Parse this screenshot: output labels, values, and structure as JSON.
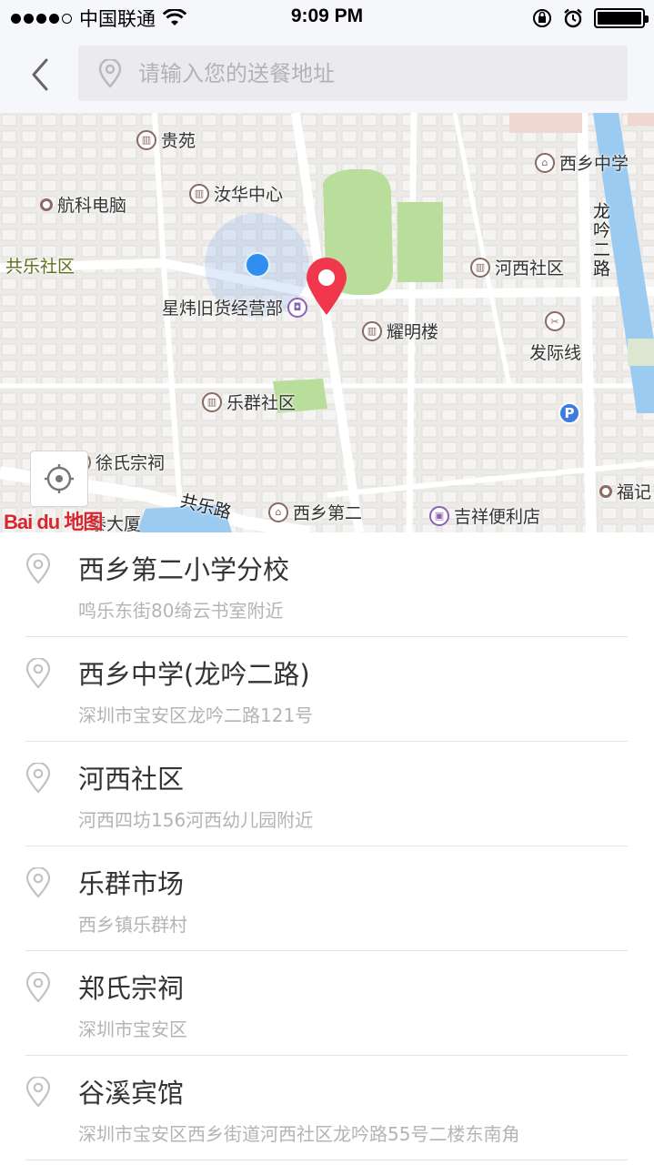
{
  "status_bar": {
    "carrier": "中国联通",
    "time": "9:09 PM"
  },
  "header": {
    "back_icon": "chevron-left-icon",
    "search_placeholder": "请输入您的送餐地址",
    "search_value": ""
  },
  "map": {
    "provider_logo": "Bai du 地图",
    "labels": {
      "guiyuan": "贵苑",
      "hangke": "航科电脑",
      "ruhua": "汝华中心",
      "xixiang_middle": "西乡中学",
      "gongle_community": "共乐社区",
      "hexi_community": "河西社区",
      "xingwei": "星炜旧货经营部",
      "yaoming": "耀明楼",
      "fajixian": "发际线",
      "lequn_community": "乐群社区",
      "xu_ancestral": "徐氏宗祠",
      "xixiang_second": "西乡第二",
      "jixiang_store": "吉祥便利店",
      "fuji": "福记",
      "tai_building": "泰大厦",
      "parking": "P"
    },
    "roads": {
      "longyin_2": "龙吟二路",
      "gongle_road": "共乐路"
    },
    "colors": {
      "user_dot": "#2f8ef0",
      "pin": "#f0374c",
      "park_green": "#b9dd9a",
      "river": "#9ccbf2"
    }
  },
  "addresses": [
    {
      "name": "西乡第二小学分校",
      "detail": "鸣乐东街80绮云书室附近"
    },
    {
      "name": "西乡中学(龙吟二路)",
      "detail": "深圳市宝安区龙吟二路121号"
    },
    {
      "name": "河西社区",
      "detail": "河西四坊156河西幼儿园附近"
    },
    {
      "name": "乐群市场",
      "detail": "西乡镇乐群村"
    },
    {
      "name": "郑氏宗祠",
      "detail": "深圳市宝安区"
    },
    {
      "name": "谷溪宾馆",
      "detail": "深圳市宝安区西乡街道河西社区龙吟路55号二楼东南角"
    }
  ]
}
